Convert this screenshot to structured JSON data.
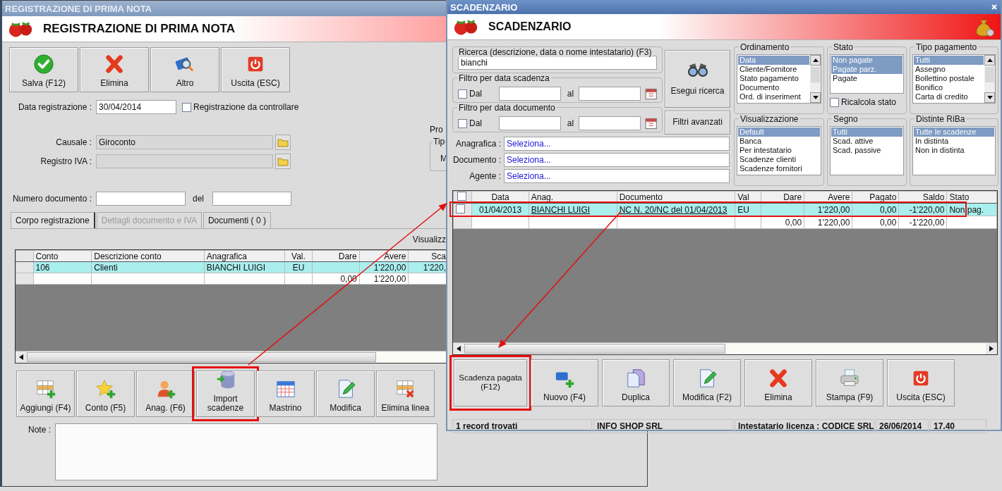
{
  "left_window": {
    "title_bar": "REGISTRAZIONE DI PRIMA NOTA",
    "header_title": "REGISTRAZIONE DI PRIMA NOTA",
    "toolbar": [
      {
        "label": "Salva (F12)",
        "kind": "check"
      },
      {
        "label": "Elimina",
        "kind": "cross"
      },
      {
        "label": "Altro",
        "kind": "search-book"
      },
      {
        "label": "Uscita (ESC)",
        "kind": "power"
      }
    ],
    "data_registrazione": {
      "label": "Data registrazione :",
      "value": "30/04/2014"
    },
    "da_controllare": {
      "label": "Registrazione da controllare",
      "checked": false
    },
    "causale": {
      "label": "Causale :",
      "value": "Giroconto"
    },
    "registro_iva": {
      "label": "Registro IVA :"
    },
    "numero_documento": {
      "label": "Numero documento :",
      "del_label": "del"
    },
    "side_group": {
      "caption": "Pro",
      "legend": "Tip",
      "text": "M"
    },
    "tabs": [
      {
        "label": "Corpo registrazione",
        "selected": true,
        "disabled": false
      },
      {
        "label": "Dettagli documento e IVA",
        "selected": false,
        "disabled": true
      },
      {
        "label": "Documenti ( 0 )",
        "selected": false,
        "disabled": false
      }
    ],
    "view_label": "Visualizz",
    "grid": {
      "columns": [
        "Conto",
        "Descrizione conto",
        "Anagrafica",
        "Val.",
        "Dare",
        "Avere",
        "Sca"
      ],
      "rows": [
        {
          "selected": true,
          "cells": {
            "conto": "106",
            "descrizione": "Clienti",
            "anagrafica": "BIANCHI LUIGI",
            "val": "EU",
            "avere": "1'220,00",
            "sca": "1'220,"
          }
        },
        {
          "selected": false,
          "cells": {
            "dare": "0,00",
            "avere": "1'220,00"
          }
        }
      ]
    },
    "bottom_buttons": [
      {
        "label": "Aggiungi (F4)",
        "kind": "grid-add",
        "highlighted": false
      },
      {
        "label": "Conto (F5)",
        "kind": "star-add",
        "highlighted": false
      },
      {
        "label": "Anag. (F6)",
        "kind": "person-add",
        "highlighted": false
      },
      {
        "label": "Import scadenze",
        "kind": "database",
        "highlighted": true
      },
      {
        "label": "Mastrino",
        "kind": "calendar",
        "highlighted": false
      },
      {
        "label": "Modifica",
        "kind": "edit",
        "highlighted": false
      },
      {
        "label": "Elimina linea",
        "kind": "grid-remove",
        "highlighted": false
      }
    ],
    "note_label": "Note :"
  },
  "right_window": {
    "title_bar": "SCADENZARIO",
    "header_title": "SCADENZARIO",
    "search": {
      "legend": "Ricerca (descrizione, data o nome intestatario) (F3)",
      "value": "bianchi"
    },
    "date_filters": [
      {
        "legend": "Filtro per data scadenza",
        "from_label": "Dal",
        "to_label": "al",
        "checked": false
      },
      {
        "legend": "Filtro per data documento",
        "from_label": "Dal",
        "to_label": "al",
        "checked": false
      }
    ],
    "search_button": "Esegui ricerca",
    "advanced_button": "Filtri avanzati",
    "lookups": [
      {
        "label": "Anagrafica :",
        "value": "Seleziona..."
      },
      {
        "label": "Documento :",
        "value": "Seleziona..."
      },
      {
        "label": "Agente :",
        "value": "Seleziona..."
      }
    ],
    "lists": [
      {
        "legend": "Ordinamento",
        "scrollbar": true,
        "items": [
          {
            "label": "Data",
            "selected": true
          },
          {
            "label": "Cliente/Fornitore",
            "selected": false
          },
          {
            "label": "Stato pagamento",
            "selected": false
          },
          {
            "label": "Documento",
            "selected": false
          },
          {
            "label": "Ord. di inseriment",
            "selected": false
          }
        ]
      },
      {
        "legend": "Stato",
        "scrollbar": false,
        "items": [
          {
            "label": "Non pagate",
            "selected": true
          },
          {
            "label": "Pagate parz.",
            "selected": true
          },
          {
            "label": "Pagate",
            "selected": false
          }
        ],
        "option": {
          "label": "Ricalcola stato",
          "checked": false
        }
      },
      {
        "legend": "Tipo pagamento",
        "scrollbar": true,
        "items": [
          {
            "label": "Tutti",
            "selected": true
          },
          {
            "label": "Assegno",
            "selected": false
          },
          {
            "label": "Bollettino postale",
            "selected": false
          },
          {
            "label": "Bonifico",
            "selected": false
          },
          {
            "label": "Carta di credito",
            "selected": false
          }
        ]
      },
      {
        "legend": "Visualizzazione",
        "scrollbar": false,
        "items": [
          {
            "label": "Default",
            "selected": true
          },
          {
            "label": "Banca",
            "selected": false
          },
          {
            "label": "Per intestatario",
            "selected": false
          },
          {
            "label": "Scadenze clienti",
            "selected": false
          },
          {
            "label": "Scadenze fornitori",
            "selected": false
          }
        ]
      },
      {
        "legend": "Segno",
        "scrollbar": false,
        "items": [
          {
            "label": "Tutti",
            "selected": true
          },
          {
            "label": "Scad. attive",
            "selected": false
          },
          {
            "label": "Scad. passive",
            "selected": false
          }
        ]
      },
      {
        "legend": "Distinte RiBa",
        "scrollbar": false,
        "items": [
          {
            "label": "Tutte le scadenze",
            "selected": true
          },
          {
            "label": "In distinta",
            "selected": false
          },
          {
            "label": "Non in distinta",
            "selected": false
          }
        ]
      }
    ],
    "grid": {
      "header_checked": false,
      "columns": [
        "Data",
        "Anag.",
        "Documento",
        "Val",
        "Dare",
        "Avere",
        "Pagato",
        "Saldo",
        "Stato"
      ],
      "rows": [
        {
          "checked": false,
          "selected": true,
          "highlighted": true,
          "cells": {
            "data": "01/04/2013",
            "anag": "BIANCHI LUIGI",
            "documento": "NC N. 20/NC del 01/04/2013",
            "val": "EU",
            "avere": "1'220,00",
            "pagato": "0,00",
            "saldo": "-1'220,00",
            "stato": "Non pag."
          }
        }
      ],
      "totals": {
        "dare": "0,00",
        "avere": "1'220,00",
        "pagato": "0,00",
        "saldo": "-1'220,00"
      }
    },
    "buttons": [
      {
        "label": "Scadenza pagata (F12)",
        "kind": "text",
        "highlighted": true
      },
      {
        "label": "Nuovo (F4)",
        "kind": "new",
        "highlighted": false
      },
      {
        "label": "Duplica",
        "kind": "copy",
        "highlighted": false
      },
      {
        "label": "Modifica (F2)",
        "kind": "edit",
        "highlighted": false
      },
      {
        "label": "Elimina",
        "kind": "cross",
        "highlighted": false
      },
      {
        "label": "Stampa (F9)",
        "kind": "printer",
        "highlighted": false
      },
      {
        "label": "Uscita (ESC)",
        "kind": "power",
        "highlighted": false
      }
    ],
    "status_bar": [
      "1 record trovati",
      "INFO SHOP SRL",
      "Intestatario licenza : CODICE SRL",
      "26/06/2014",
      "17.40"
    ]
  }
}
